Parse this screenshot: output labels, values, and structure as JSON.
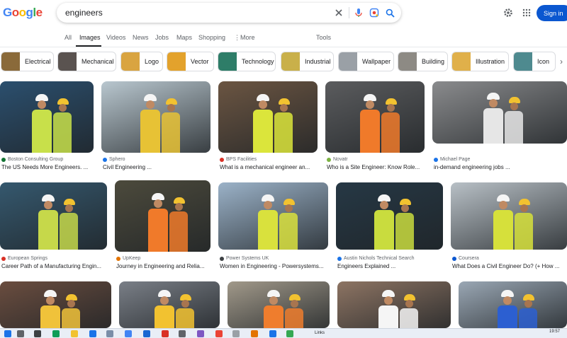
{
  "logo": {
    "letters": [
      "G",
      "o",
      "o",
      "g",
      "l",
      "e"
    ],
    "colors": [
      "#4285f4",
      "#ea4335",
      "#fbbc05",
      "#4285f4",
      "#34a853",
      "#ea4335"
    ]
  },
  "search": {
    "query": "engineers"
  },
  "header": {
    "sign_in": "Sign in"
  },
  "tabs": [
    {
      "label": "All",
      "active": false
    },
    {
      "label": "Images",
      "active": true
    },
    {
      "label": "Videos",
      "active": false
    },
    {
      "label": "News",
      "active": false
    },
    {
      "label": "Jobs",
      "active": false
    },
    {
      "label": "Maps",
      "active": false
    },
    {
      "label": "Shopping",
      "active": false
    },
    {
      "label": "More",
      "active": false
    },
    {
      "label": "Tools",
      "active": false
    }
  ],
  "chips": [
    {
      "label": "Electrical",
      "color": "#8a6a3a"
    },
    {
      "label": "Mechanical",
      "color": "#5a5350"
    },
    {
      "label": "Logo",
      "color": "#d9a441"
    },
    {
      "label": "Vector",
      "color": "#e3a22c"
    },
    {
      "label": "Technology",
      "color": "#2e7d68"
    },
    {
      "label": "Industrial",
      "color": "#c9b04a"
    },
    {
      "label": "Wallpaper",
      "color": "#9aa0a6"
    },
    {
      "label": "Building",
      "color": "#8d8a84"
    },
    {
      "label": "Illustration",
      "color": "#e0b04a"
    },
    {
      "label": "Icon",
      "color": "#4e8a8f"
    }
  ],
  "results": [
    {
      "source": "Boston Consulting Group",
      "title": "The US Needs More Engineers. ...",
      "fav": "#137333",
      "bg": "#2b4f6e",
      "accent": "#c8e04a"
    },
    {
      "source": "Sphero",
      "title": "Civil Engineering ...",
      "fav": "#1a73e8",
      "bg": "#b9c7cf",
      "accent": "#e7c235"
    },
    {
      "source": "BPS Facilities",
      "title": "What is a mechanical engineer an...",
      "fav": "#d93025",
      "bg": "#6b5542",
      "accent": "#dbe53b"
    },
    {
      "source": "Novatr",
      "title": "Who is a Site Engineer: Know Role...",
      "fav": "#7cb342",
      "bg": "#5b5c5e",
      "accent": "#f07a2a"
    },
    {
      "source": "Michael Page",
      "title": "in-demand engineering jobs ...",
      "fav": "#1a73e8",
      "bg": "#8a8b8d",
      "accent": "#e6e6e6"
    },
    {
      "source": "European Springs",
      "title": "Career Path of a Manufacturing Engin...",
      "fav": "#d93025",
      "bg": "#35586e",
      "accent": "#c6d84a"
    },
    {
      "source": "UpKeep",
      "title": "Journey in Engineering and Relia...",
      "fav": "#e37400",
      "bg": "#4c4a3c",
      "accent": "#f07a2a"
    },
    {
      "source": "Power Systems UK",
      "title": "Women in Engineering - Powersystems...",
      "fav": "#3c4043",
      "bg": "#9bb2c8",
      "accent": "#d9e13d"
    },
    {
      "source": "Austin Nichols Technical Search",
      "title": "Engineers Explained ...",
      "fav": "#1a73e8",
      "bg": "#263845",
      "accent": "#c9dc3e"
    },
    {
      "source": "Coursera",
      "title": "What Does a Civil Engineer Do? (+ How ...",
      "fav": "#0b57d0",
      "bg": "#b8c0c6",
      "accent": "#d6e03b"
    },
    {
      "source": "",
      "title": "",
      "fav": "#ffffff",
      "bg": "#6a4d3f",
      "accent": "#f0c23a"
    },
    {
      "source": "",
      "title": "",
      "fav": "#ffffff",
      "bg": "#7a7f87",
      "accent": "#f2c230"
    },
    {
      "source": "",
      "title": "",
      "fav": "#ffffff",
      "bg": "#a1998a",
      "accent": "#ef7d2d"
    },
    {
      "source": "",
      "title": "",
      "fav": "#ffffff",
      "bg": "#8d7463",
      "accent": "#f5f5f5"
    },
    {
      "source": "",
      "title": "",
      "fav": "#ffffff",
      "bg": "#9aa7b4",
      "accent": "#2c5fd1"
    }
  ],
  "taskbar": {
    "links_label": "Links",
    "time": "19:57"
  }
}
